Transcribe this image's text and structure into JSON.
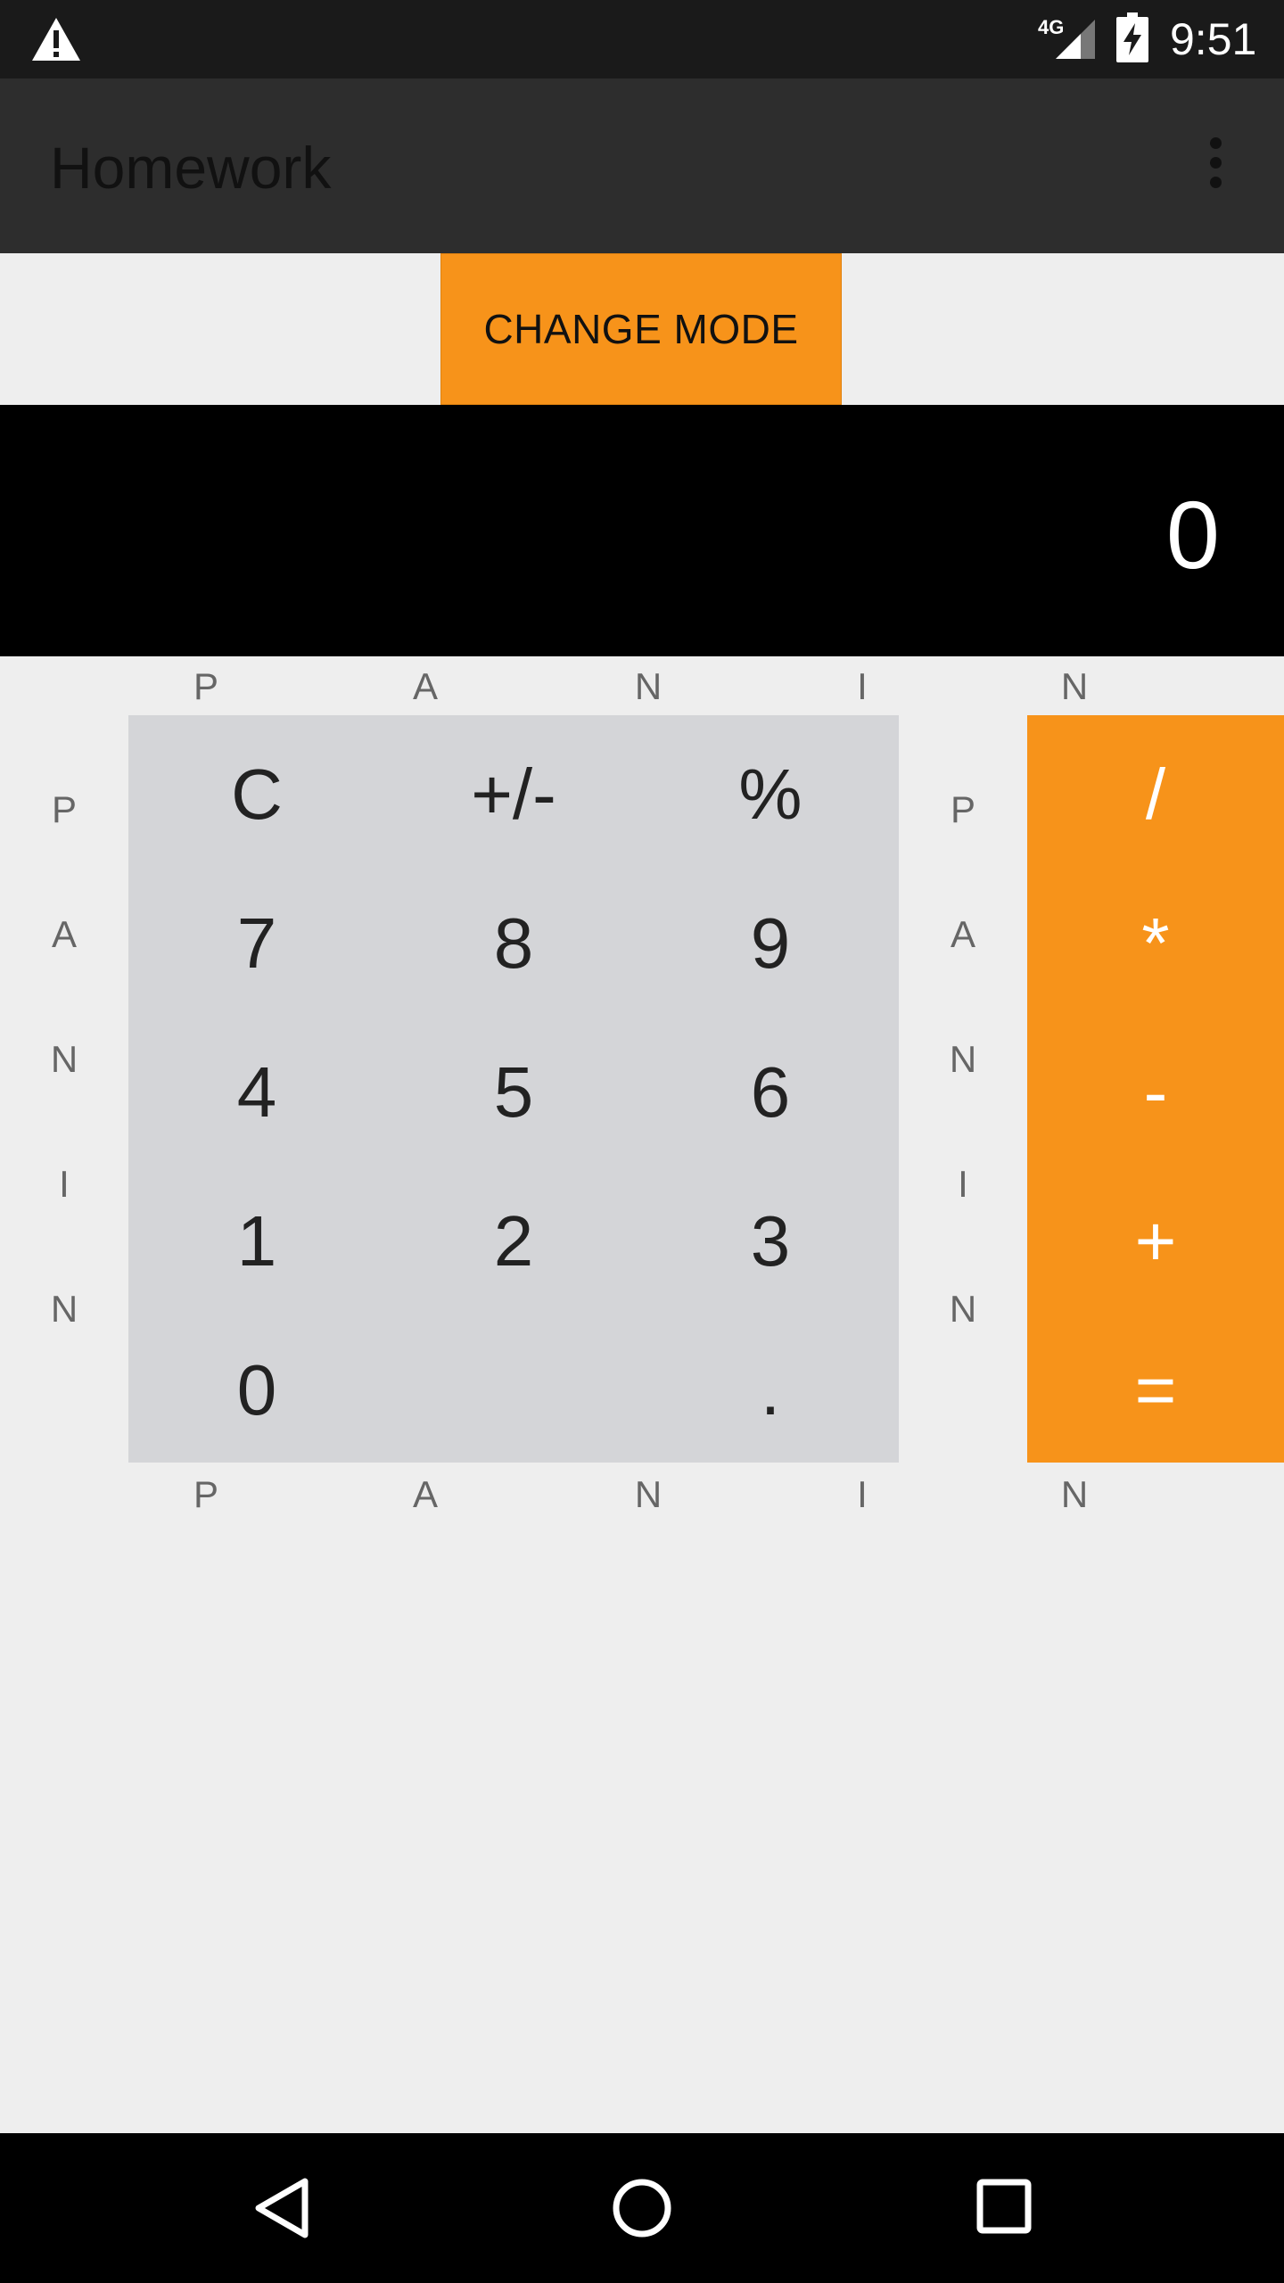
{
  "status_bar": {
    "network": "4G",
    "time": "9:51",
    "icons": [
      "warning-icon",
      "signal-icon",
      "battery-charging-icon"
    ]
  },
  "app_bar": {
    "title": "Homework",
    "overflow_icon": "more-vert-icon"
  },
  "mode_button": {
    "label": "CHANGE MODE",
    "color": "#f7931a"
  },
  "display": {
    "value": "0"
  },
  "pan_label": {
    "letters": [
      "P",
      "A",
      "N",
      "I",
      "N"
    ]
  },
  "keypad": {
    "rows": [
      [
        "C",
        "+/-",
        "%"
      ],
      [
        "7",
        "8",
        "9"
      ],
      [
        "4",
        "5",
        "6"
      ],
      [
        "1",
        "2",
        "3"
      ],
      [
        "0",
        "",
        "."
      ]
    ],
    "background": "#d4d5d8"
  },
  "operators": {
    "keys": [
      "/",
      "*",
      "-",
      "+",
      "="
    ],
    "background": "#f7931a"
  },
  "nav_bar": {
    "icons": [
      "back-icon",
      "home-icon",
      "recents-icon"
    ]
  }
}
